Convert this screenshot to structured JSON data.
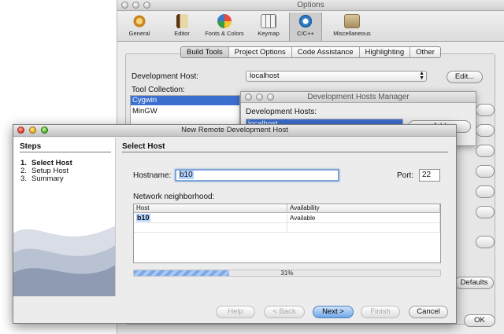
{
  "options": {
    "title": "Options",
    "toolbar": [
      {
        "label": "General",
        "icon": "gear-icon",
        "color": "#d8a23b"
      },
      {
        "label": "Editor",
        "icon": "editor-icon",
        "color": "#6b3d12"
      },
      {
        "label": "Fonts & Colors",
        "icon": "fonts-colors-icon",
        "color": "#3b79c4"
      },
      {
        "label": "Keymap",
        "icon": "keymap-icon",
        "color": "#8e8e8e"
      },
      {
        "label": "C/C++",
        "icon": "cpp-icon",
        "color": "#3a8bd6"
      },
      {
        "label": "Miscellaneous",
        "icon": "misc-icon",
        "color": "#b7a07a"
      }
    ],
    "tabs": [
      "Build Tools",
      "Project Options",
      "Code Assistance",
      "Highlighting",
      "Other"
    ],
    "active_tab": "Build Tools",
    "dev_host_label": "Development Host:",
    "dev_host_value": "localhost",
    "edit_button": "Edit...",
    "tool_collection_label": "Tool Collection:",
    "tool_collections": [
      "Cygwin",
      "MinGW"
    ],
    "defaults_button": "Defaults",
    "ok_button": "OK"
  },
  "dhm": {
    "title": "Development Hosts Manager",
    "hosts_label": "Development Hosts:",
    "selected_host": "localhost",
    "add_button": "Add"
  },
  "wizard": {
    "title": "New Remote Development Host",
    "steps_title": "Steps",
    "steps": [
      {
        "num": "1.",
        "label": "Select Host"
      },
      {
        "num": "2.",
        "label": "Setup Host"
      },
      {
        "num": "3.",
        "label": "Summary"
      }
    ],
    "current_step": 1,
    "panel_title": "Select Host",
    "hostname_label": "Hostname:",
    "hostname_value": "b10",
    "port_label": "Port:",
    "port_value": "22",
    "network_label": "Network neighborhood:",
    "table_headers": [
      "Host",
      "Availability"
    ],
    "table_rows": [
      [
        "b10",
        "Available"
      ]
    ],
    "progress_percent": 31,
    "progress_text": "31%",
    "buttons": {
      "help": "Help",
      "back": "< Back",
      "next": "Next >",
      "finish": "Finish",
      "cancel": "Cancel"
    }
  }
}
